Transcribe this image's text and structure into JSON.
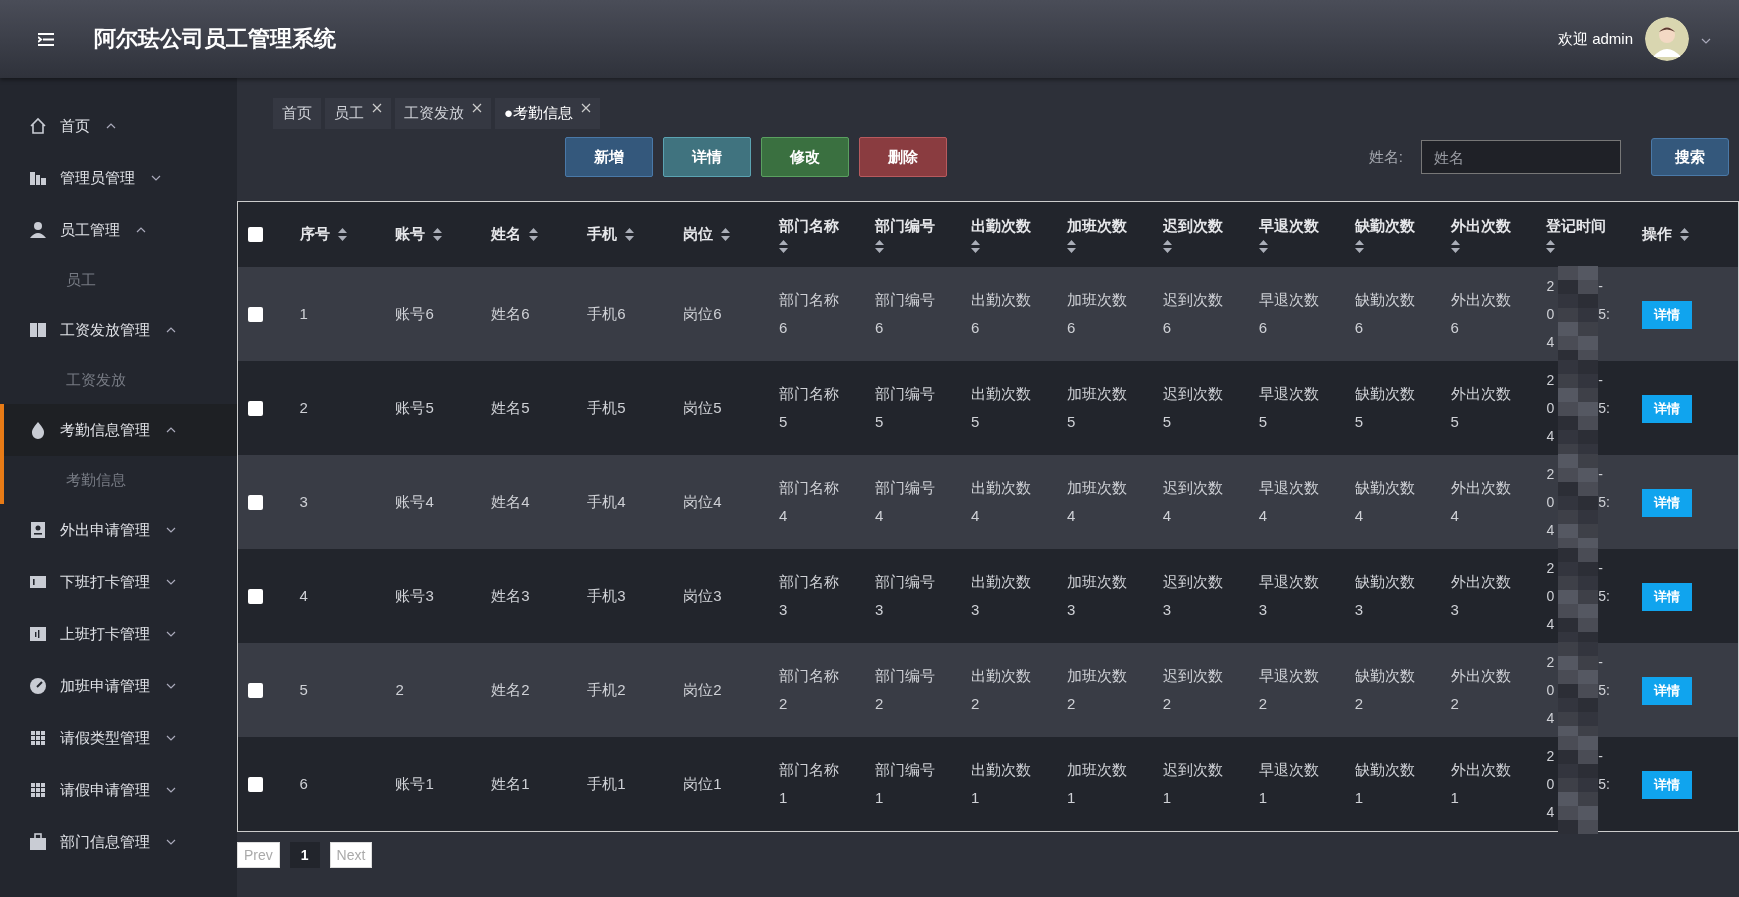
{
  "header": {
    "title": "阿尔珐公司员工管理系统",
    "welcome": "欢迎 admin"
  },
  "sidebar": {
    "items": [
      {
        "label": "首页",
        "expanded": true,
        "selected": false
      },
      {
        "label": "管理员管理",
        "expanded": false,
        "selected": false
      },
      {
        "label": "员工管理",
        "expanded": true,
        "selected": false,
        "children": [
          {
            "label": "员工"
          }
        ]
      },
      {
        "label": "工资发放管理",
        "expanded": true,
        "selected": false,
        "children": [
          {
            "label": "工资发放"
          }
        ]
      },
      {
        "label": "考勤信息管理",
        "expanded": true,
        "selected": true,
        "children": [
          {
            "label": "考勤信息"
          }
        ]
      },
      {
        "label": "外出申请管理",
        "expanded": false,
        "selected": false
      },
      {
        "label": "下班打卡管理",
        "expanded": false,
        "selected": false
      },
      {
        "label": "上班打卡管理",
        "expanded": false,
        "selected": false
      },
      {
        "label": "加班申请管理",
        "expanded": false,
        "selected": false
      },
      {
        "label": "请假类型管理",
        "expanded": false,
        "selected": false
      },
      {
        "label": "请假申请管理",
        "expanded": false,
        "selected": false
      },
      {
        "label": "部门信息管理",
        "expanded": false,
        "selected": false
      }
    ]
  },
  "tabs": [
    {
      "label": "首页",
      "closable": false,
      "selected": false
    },
    {
      "label": "员工",
      "closable": true,
      "selected": false
    },
    {
      "label": "工资发放",
      "closable": true,
      "selected": false
    },
    {
      "label": "考勤信息",
      "closable": true,
      "selected": true,
      "marker": "●"
    }
  ],
  "toolbar": [
    {
      "label": "新增",
      "kind": "add"
    },
    {
      "label": "详情",
      "kind": "detail"
    },
    {
      "label": "修改",
      "kind": "edit"
    },
    {
      "label": "删除",
      "kind": "delete"
    }
  ],
  "search": {
    "label": "姓名:",
    "placeholder": "姓名",
    "button": "搜索"
  },
  "table": {
    "all_checked": false,
    "columns": [
      "序号",
      "账号",
      "姓名",
      "手机",
      "岗位",
      "部门名称",
      "部门编号",
      "出勤次数",
      "加班次数",
      "迟到次数",
      "早退次数",
      "缺勤次数",
      "外出次数",
      "登记时间",
      "操作"
    ],
    "rows": [
      {
        "checked": false,
        "cells": [
          "1",
          "账号6",
          "姓名6",
          "手机6",
          "岗位6",
          "部门名称6",
          "部门编号6",
          "出勤次数6",
          "加班次数6",
          "迟到次数6",
          "早退次数6",
          "缺勤次数6",
          "外出次数6"
        ],
        "time_left": [
          "2",
          "0",
          "4"
        ],
        "time_right": [
          "-",
          "5:"
        ],
        "action": "详情"
      },
      {
        "checked": false,
        "cells": [
          "2",
          "账号5",
          "姓名5",
          "手机5",
          "岗位5",
          "部门名称5",
          "部门编号5",
          "出勤次数5",
          "加班次数5",
          "迟到次数5",
          "早退次数5",
          "缺勤次数5",
          "外出次数5"
        ],
        "time_left": [
          "2",
          "0",
          "4"
        ],
        "time_right": [
          "-",
          "5:"
        ],
        "action": "详情"
      },
      {
        "checked": false,
        "cells": [
          "3",
          "账号4",
          "姓名4",
          "手机4",
          "岗位4",
          "部门名称4",
          "部门编号4",
          "出勤次数4",
          "加班次数4",
          "迟到次数4",
          "早退次数4",
          "缺勤次数4",
          "外出次数4"
        ],
        "time_left": [
          "2",
          "0",
          "4"
        ],
        "time_right": [
          "-",
          "5:"
        ],
        "action": "详情"
      },
      {
        "checked": false,
        "cells": [
          "4",
          "账号3",
          "姓名3",
          "手机3",
          "岗位3",
          "部门名称3",
          "部门编号3",
          "出勤次数3",
          "加班次数3",
          "迟到次数3",
          "早退次数3",
          "缺勤次数3",
          "外出次数3"
        ],
        "time_left": [
          "2",
          "0",
          "4"
        ],
        "time_right": [
          "-",
          "5:"
        ],
        "action": "详情"
      },
      {
        "checked": false,
        "cells": [
          "5",
          "2",
          "姓名2",
          "手机2",
          "岗位2",
          "部门名称2",
          "部门编号2",
          "出勤次数2",
          "加班次数2",
          "迟到次数2",
          "早退次数2",
          "缺勤次数2",
          "外出次数2"
        ],
        "time_left": [
          "2",
          "0",
          "4"
        ],
        "time_right": [
          "-",
          "5:"
        ],
        "action": "详情"
      },
      {
        "checked": false,
        "cells": [
          "6",
          "账号1",
          "姓名1",
          "手机1",
          "岗位1",
          "部门名称1",
          "部门编号1",
          "出勤次数1",
          "加班次数1",
          "迟到次数1",
          "早退次数1",
          "缺勤次数1",
          "外出次数1"
        ],
        "time_left": [
          "2",
          "0",
          "4"
        ],
        "time_right": [
          "-",
          "5:"
        ],
        "action": "详情"
      }
    ]
  },
  "pagination": {
    "prev": "Prev",
    "pages": [
      {
        "label": "1",
        "selected": true
      }
    ],
    "next": "Next"
  }
}
